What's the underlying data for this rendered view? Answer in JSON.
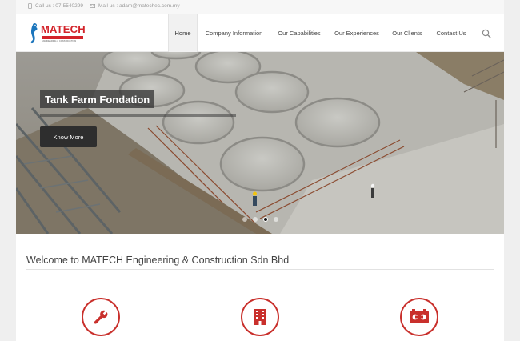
{
  "topbar": {
    "phone_text": "Call us : 07-5540299",
    "mail_text": "Mail us : adam@matechec.com.my",
    "phone_icon": "phone-icon",
    "mail_icon": "envelope-icon"
  },
  "logo": {
    "text": "MATECH",
    "subtext": "ENGINEERING & CONSTRUCTION",
    "icon": "seahorse-logo-icon"
  },
  "nav": {
    "items": [
      {
        "label": "Home",
        "active": true
      },
      {
        "label": "Company Information",
        "active": false
      },
      {
        "label": "Our Capabilities",
        "active": false
      },
      {
        "label": "Our Experiences",
        "active": false
      },
      {
        "label": "Our Clients",
        "active": false
      },
      {
        "label": "Contact Us",
        "active": false
      }
    ],
    "search_icon": "search-icon"
  },
  "slider": {
    "caption": "Tank Farm Fondation",
    "button_label": "Know More",
    "slide_count": 4,
    "active_slide": 3
  },
  "welcome": {
    "title": "Welcome to MATECH Engineering & Construction Sdn Bhd"
  },
  "features": [
    {
      "icon": "wrench-icon"
    },
    {
      "icon": "building-icon"
    },
    {
      "icon": "tape-icon"
    }
  ],
  "colors": {
    "brand_red": "#d3232a",
    "icon_border": "#c9302c",
    "background": "#efefef"
  }
}
